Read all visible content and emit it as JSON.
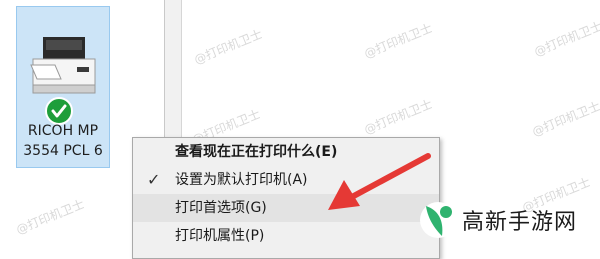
{
  "watermark_text": "@打印机卫士",
  "device": {
    "name_line1": "RICOH MP",
    "name_line2": "3554 PCL 6",
    "icon": "printer-icon",
    "status_icon": "default-check-icon",
    "status_color": "#1e9e3a"
  },
  "context_menu": {
    "items": [
      {
        "label": "查看现在正在打印什么(E)",
        "bold": true
      },
      {
        "label": "设置为默认打印机(A)",
        "checked": true
      },
      {
        "label": "打印首选项(G)",
        "highlighted": true
      },
      {
        "label": "打印机属性(P)"
      }
    ]
  },
  "annotation": {
    "icon": "red-arrow-icon",
    "color": "#e53935"
  },
  "brand": {
    "text": "高新手游网",
    "logo_icon": "brand-logo-icon",
    "logo_color": "#2fb36f"
  }
}
